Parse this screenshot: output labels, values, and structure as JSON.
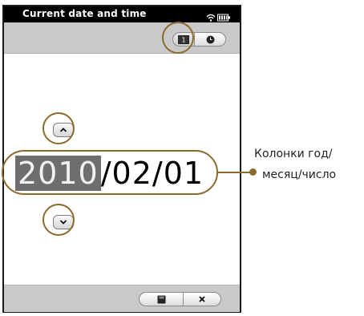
{
  "status_bar": {
    "title": "Current date and time",
    "wifi_icon": "wifi-icon",
    "battery_icon": "battery-icon"
  },
  "top_toolbar": {
    "date_mode": {
      "label": "1",
      "icon": "calendar-icon"
    },
    "time_mode": {
      "icon": "clock-icon"
    }
  },
  "date_editor": {
    "year": "2010",
    "separator_1": "/",
    "month": "02",
    "separator_2": "/",
    "day": "01",
    "up_icon": "chevron-up-icon",
    "down_icon": "chevron-down-icon"
  },
  "bottom_toolbar": {
    "save_icon": "save-icon",
    "cancel_icon": "close-icon"
  },
  "callout": {
    "line_1": "Колонки год/",
    "line_2": "месяц/число",
    "color": "#8b6a2c"
  }
}
